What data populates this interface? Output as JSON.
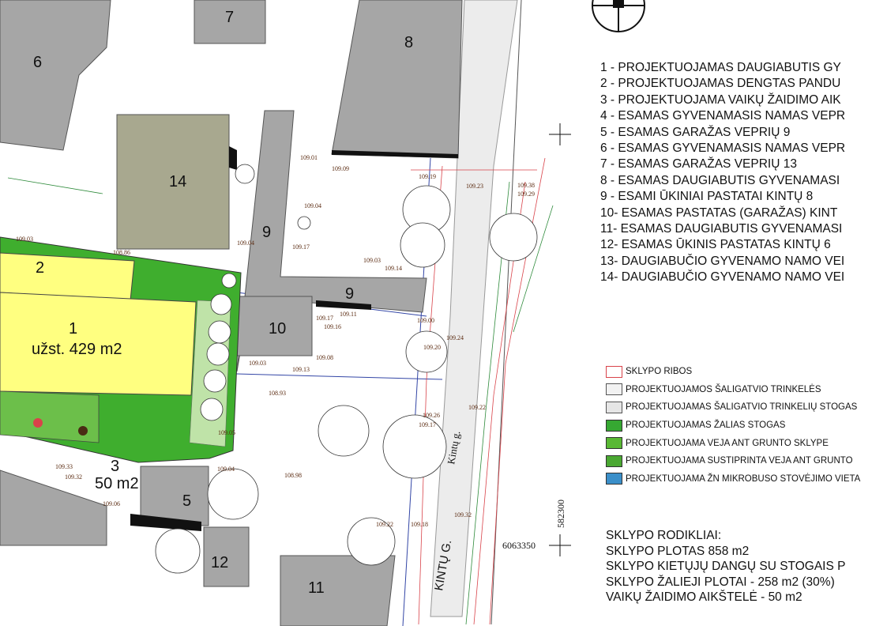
{
  "legend": [
    {
      "num": "1 -",
      "text": "PROJEKTUOJAMAS DAUGIABUTIS GY"
    },
    {
      "num": "2 -",
      "text": "PROJEKTUOJAMAS DENGTAS PANDU"
    },
    {
      "num": "3 -",
      "text": "PROJEKTUOJAMA VAIKŲ ŽAIDIMO AIK"
    },
    {
      "num": "4 -",
      "text": "ESAMAS GYVENAMASIS NAMAS VEPR"
    },
    {
      "num": "5 -",
      "text": "ESAMAS GARAŽAS VEPRIŲ 9"
    },
    {
      "num": "6 -",
      "text": "ESAMAS GYVENAMASIS NAMAS VEPR"
    },
    {
      "num": "7 -",
      "text": "ESAMAS GARAŽAS VEPRIŲ 13"
    },
    {
      "num": "8 -",
      "text": "ESAMAS DAUGIABUTIS GYVENAMASI"
    },
    {
      "num": "9 -",
      "text": "ESAMI ŪKINIAI PASTATAI  KINTŲ 8"
    },
    {
      "num": "10-",
      "text": "ESAMAS PASTATAS (GARAŽAS) KINT"
    },
    {
      "num": "11-",
      "text": "ESAMAS DAUGIABUTIS GYVENAMASI"
    },
    {
      "num": "12-",
      "text": "ESAMAS ŪKINIS PASTATAS  KINTŲ 6"
    },
    {
      "num": "13-",
      "text": "DAUGIABUČIO GYVENAMO NAMO VEI"
    },
    {
      "num": "14-",
      "text": "DAUGIABUČIO GYVENAMO NAMO VEI"
    }
  ],
  "key": [
    {
      "label": "SKLYPO RIBOS",
      "fill": "#ffffff",
      "border": "#d9434a"
    },
    {
      "label": "PROJEKTUOJAMOS ŠALIGATVIO TRINKELĖS",
      "fill": "#f2f2f2",
      "border": "#555"
    },
    {
      "label": "PROJEKTUOJAMAS ŠALIGATVIO TRINKELIŲ STOGAS",
      "fill": "#e6e6e6",
      "border": "#555"
    },
    {
      "label": "PROJEKTUOJAMAS ŽALIAS STOGAS",
      "fill": "#36a832",
      "border": "#333"
    },
    {
      "label": "PROJEKTUOJAMA VEJA ANT GRUNTO SKLYPE",
      "fill": "#59b834",
      "border": "#333"
    },
    {
      "label": "PROJEKTUOJAMA SUSTIPRINTA VEJA ANT GRUNTO",
      "fill": "#4aa832",
      "border": "#333"
    },
    {
      "label": "PROJEKTUOJAMA ŽN MIKROBUSO STOVĖJIMO VIETA",
      "fill": "#3b8fc9",
      "border": "#333"
    }
  ],
  "stats": {
    "title": "SKLYPO RODIKLIAI:",
    "lines": [
      "SKLYPO PLOTAS 858 m2",
      "SKLYPO KIETŲJŲ DANGŲ SU STOGAIS P",
      "SKLYPO ŽALIEJI PLOTAI - 258 m2 (30%)",
      "VAIKŲ ŽAIDIMO AIKŠTELĖ - 50 m2"
    ]
  },
  "buildings": {
    "b1": "1",
    "b1_area": "užst. 429 m2",
    "b2": "2",
    "b3": "3",
    "b3_area": "50 m2",
    "b5": "5",
    "b6": "6",
    "b7": "7",
    "b8": "8",
    "b9a": "9",
    "b9b": "9",
    "b10": "10",
    "b11": "11",
    "b12": "12",
    "b14": "14"
  },
  "street": {
    "name1": "Kintų g.",
    "name2": "KINTŲ G."
  },
  "coords": {
    "x": "582300",
    "y": "6063350"
  },
  "elevations": [
    "109.03",
    "108.86",
    "109.01",
    "109.09",
    "109.04",
    "109.17",
    "109.03",
    "109.14",
    "109.19",
    "109.17",
    "109.11",
    "109.16",
    "109.08",
    "109.03",
    "109.13",
    "108.93",
    "109.05",
    "108.98",
    "109.04",
    "109.33",
    "109.32",
    "109.06",
    "109.22",
    "109.18",
    "109.32",
    "109.24",
    "109.20",
    "109.26",
    "109.17",
    "109.22",
    "109.00",
    "109.38",
    "109.29",
    "109.23",
    "109.04"
  ],
  "colors": {
    "building": "#a6a6a6",
    "planned": "#ffff80",
    "green": "#3fae2e",
    "annex": "#a8a88f",
    "road": "#e9e9e9"
  }
}
